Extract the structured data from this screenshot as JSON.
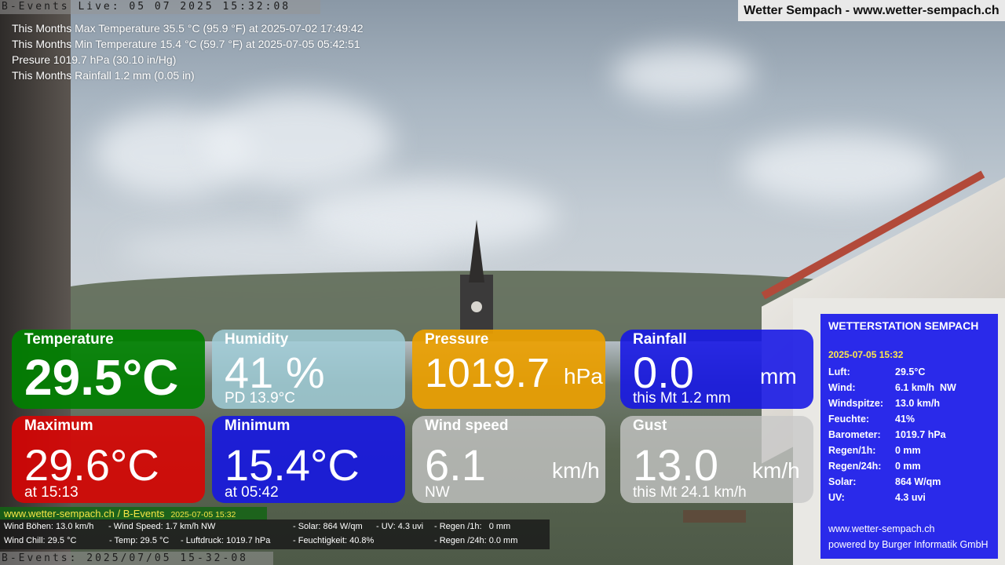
{
  "live_bar": "B-Events Live: 05 07 2025 15:32:08",
  "site_title": "Wetter Sempach - www.wetter-sempach.ch",
  "stats": [
    "This Months Max Temperature 35.5 °C (95.9 °F) at 2025-07-02 17:49:42",
    "This Months Min Temperature 15.4 °C (59.7 °F) at 2025-07-05 05:42:51",
    "Presure 1019.7 hPa (30.10 in/Hg)",
    "This Months Rainfall 1.2 mm (0.05 in)"
  ],
  "tiles": {
    "temperature": {
      "label": "Temperature",
      "value": "29.5°C",
      "color": "#008000"
    },
    "humidity": {
      "label": "Humidity",
      "value": "41 %",
      "sub": "PD 13.9°C",
      "color": "#a0cdd7"
    },
    "pressure": {
      "label": "Pressure",
      "value": "1019.7",
      "unit": "hPa",
      "color": "#eba000"
    },
    "rainfall": {
      "label": "Rainfall",
      "value": "0.0",
      "unit": "mm",
      "sub": "this Mt 1.2 mm",
      "color": "#1414e6"
    },
    "maximum": {
      "label": "Maximum",
      "value": "29.6°C",
      "sub": "at 15:13",
      "color": "#e10000"
    },
    "minimum": {
      "label": "Minimum",
      "value": "15.4°C",
      "sub": "at 05:42",
      "color": "#1414e6"
    },
    "wind_speed": {
      "label": "Wind speed",
      "value": "6.1",
      "unit": "km/h",
      "sub": "NW",
      "color": "#c8c8c8"
    },
    "gust": {
      "label": "Gust",
      "value": "13.0",
      "unit": "km/h",
      "sub": "this Mt 24.1 km/h",
      "color": "#c8c8c8"
    }
  },
  "panel": {
    "title": "WETTERSTATION SEMPACH",
    "date": "2025-07-05 15:32",
    "rows": [
      {
        "k": "Luft:",
        "v": "29.5°C"
      },
      {
        "k": "Wind:",
        "v": "6.1 km/h  NW"
      },
      {
        "k": "Windspitze:",
        "v": "13.0 km/h"
      },
      {
        "k": "Feuchte:",
        "v": "41%"
      },
      {
        "k": "Barometer:",
        "v": "1019.7 hPa"
      },
      {
        "k": "Regen/1h:",
        "v": "0 mm"
      },
      {
        "k": "Regen/24h:",
        "v": "0 mm"
      },
      {
        "k": "Solar:",
        "v": "864 W/qm"
      },
      {
        "k": "UV:",
        "v": "4.3 uvi"
      }
    ],
    "footer_site": "www.wetter-sempach.ch",
    "footer_credit": "powered by Burger Informatik GmbH"
  },
  "link_strip": {
    "text": "www.wetter-sempach.ch / B-Events",
    "date": "2025-07-05 15:32"
  },
  "data_strip": {
    "r1a": "Wind Böhen: 13.0 km/h",
    "r1b": "- Wind Speed: 1.7 km/h NW",
    "r1c": "- Solar: 864 W/qm",
    "r1d": "- UV: 4.3 uvi",
    "r1e": "- Regen /1h:   0 mm",
    "r2a": "Wind Chill: 29.5 °C",
    "r2b": "- Temp: 29.5 °C",
    "r2c": "- Luftdruck: 1019.7 hPa",
    "r2d": "- Feuchtigkeit: 40.8%",
    "r2e": "- Regen /24h: 0.0 mm"
  },
  "bottom_bar": "B-Events: 2025/07/05 15-32-08"
}
